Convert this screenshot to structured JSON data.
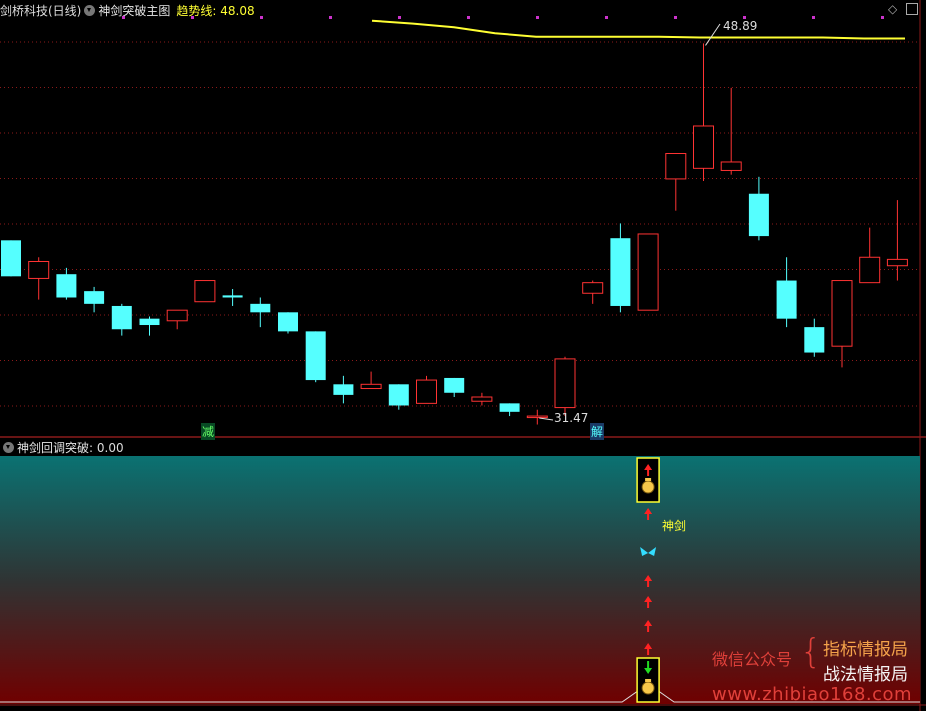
{
  "header": {
    "stock_title": "剑桥科技(日线)",
    "indicator_main": "神剑突破主图",
    "trend_label": "趋势线:",
    "trend_value": "48.08"
  },
  "sub_header": {
    "indicator_sub": "神剑回调突破",
    "value_text": ": 0.00"
  },
  "annotations": {
    "high_label": "48.89",
    "low_label": "31.47",
    "signal_jian": "减",
    "signal_jie": "解",
    "shenjian": "神剑"
  },
  "watermark": {
    "wechat": "微信公众号",
    "brace": "{",
    "line1": "指标情报局",
    "line2": "战法情报局",
    "url": "www.zhibiao168.com"
  },
  "colors": {
    "up": "#ff3333",
    "down": "#55ffff",
    "trend": "#ffff33",
    "grid": "#8b1a1a",
    "dots": "#cc33cc"
  },
  "chart_data": {
    "type": "candlestick",
    "title": "剑桥科技(日线)",
    "indicator": "神剑突破主图",
    "trend_line_last": 48.08,
    "labeled_high": 48.89,
    "labeled_low": 31.47,
    "ylim": [
      30.5,
      50.1
    ],
    "candles": [
      {
        "o": 39.6,
        "h": 39.6,
        "l": 37.9,
        "c": 37.9
      },
      {
        "o": 37.8,
        "h": 38.8,
        "l": 36.8,
        "c": 38.6
      },
      {
        "o": 38.0,
        "h": 38.3,
        "l": 36.8,
        "c": 36.9
      },
      {
        "o": 37.2,
        "h": 37.4,
        "l": 36.2,
        "c": 36.6
      },
      {
        "o": 36.5,
        "h": 36.6,
        "l": 35.1,
        "c": 35.4
      },
      {
        "o": 35.9,
        "h": 36.0,
        "l": 35.1,
        "c": 35.6
      },
      {
        "o": 35.8,
        "h": 36.3,
        "l": 35.4,
        "c": 36.3
      },
      {
        "o": 36.7,
        "h": 37.6,
        "l": 36.7,
        "c": 37.7
      },
      {
        "o": 37.0,
        "h": 37.3,
        "l": 36.5,
        "c": 36.9
      },
      {
        "o": 36.6,
        "h": 36.9,
        "l": 35.5,
        "c": 36.2
      },
      {
        "o": 36.2,
        "h": 36.2,
        "l": 35.2,
        "c": 35.3
      },
      {
        "o": 35.3,
        "h": 35.3,
        "l": 32.9,
        "c": 33.0
      },
      {
        "o": 32.8,
        "h": 33.2,
        "l": 31.9,
        "c": 32.3
      },
      {
        "o": 32.6,
        "h": 33.4,
        "l": 32.6,
        "c": 32.8
      },
      {
        "o": 32.8,
        "h": 32.8,
        "l": 31.6,
        "c": 31.8
      },
      {
        "o": 31.9,
        "h": 33.2,
        "l": 31.9,
        "c": 33.0
      },
      {
        "o": 33.1,
        "h": 33.1,
        "l": 32.2,
        "c": 32.4
      },
      {
        "o": 32.0,
        "h": 32.4,
        "l": 31.8,
        "c": 32.2
      },
      {
        "o": 31.9,
        "h": 31.9,
        "l": 31.3,
        "c": 31.5
      },
      {
        "o": 31.3,
        "h": 31.6,
        "l": 30.9,
        "c": 31.3
      },
      {
        "o": 31.7,
        "h": 34.1,
        "l": 31.3,
        "c": 34.0
      },
      {
        "o": 37.1,
        "h": 37.7,
        "l": 36.6,
        "c": 37.6
      },
      {
        "o": 39.7,
        "h": 40.4,
        "l": 36.2,
        "c": 36.5
      },
      {
        "o": 36.3,
        "h": 39.9,
        "l": 36.3,
        "c": 39.9
      },
      {
        "o": 42.5,
        "h": 42.5,
        "l": 41.0,
        "c": 43.7
      },
      {
        "o": 43.0,
        "h": 48.9,
        "l": 42.4,
        "c": 45.0
      },
      {
        "o": 42.9,
        "h": 46.8,
        "l": 42.7,
        "c": 43.3
      },
      {
        "o": 41.8,
        "h": 42.6,
        "l": 39.6,
        "c": 39.8
      },
      {
        "o": 37.7,
        "h": 38.8,
        "l": 35.5,
        "c": 35.9
      },
      {
        "o": 35.5,
        "h": 35.9,
        "l": 34.1,
        "c": 34.3
      },
      {
        "o": 34.6,
        "h": 37.7,
        "l": 33.6,
        "c": 37.7
      },
      {
        "o": 37.6,
        "h": 40.2,
        "l": 37.6,
        "c": 38.8
      },
      {
        "o": 38.4,
        "h": 41.5,
        "l": 37.7,
        "c": 38.7
      }
    ],
    "trend_line": [
      48.12,
      48.0,
      47.85,
      47.6,
      47.45,
      47.45,
      47.45,
      47.45,
      47.42,
      47.42,
      47.42,
      47.42,
      47.38,
      47.38
    ],
    "signals": {
      "jian_index": 7,
      "jie_index": 21
    },
    "sub_indicator": {
      "name": "神剑回调突破",
      "value": 0.0,
      "signal_index": 23
    }
  }
}
